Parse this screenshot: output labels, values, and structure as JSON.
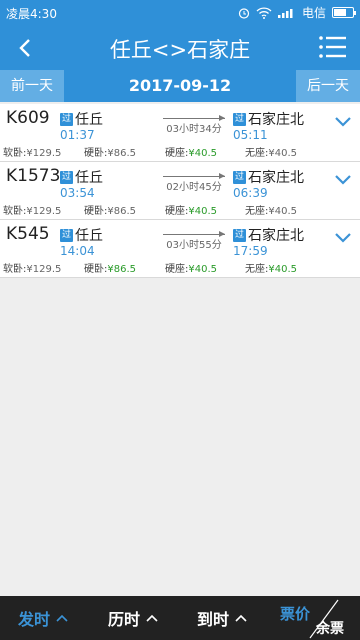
{
  "status_bar": {
    "time": "凌晨4:30",
    "carrier": "电信"
  },
  "header": {
    "title": "任丘<>石家庄"
  },
  "date_bar": {
    "prev_day": "前一天",
    "date": "2017-09-12",
    "next_day": "后一天"
  },
  "trains": [
    {
      "train_no": "K609",
      "pass_badge": "过",
      "dep_station": "任丘",
      "dep_time": "01:37",
      "duration": "03小时34分",
      "arr_station": "石家庄北",
      "arr_time": "05:11",
      "fares": [
        {
          "label": "软卧:",
          "value": "¥129.5",
          "available": false
        },
        {
          "label": "硬卧:",
          "value": "¥86.5",
          "available": false
        },
        {
          "label": "硬座:",
          "value": "¥40.5",
          "available": true
        },
        {
          "label": "无座:",
          "value": "¥40.5",
          "available": false
        }
      ]
    },
    {
      "train_no": "K1573",
      "pass_badge": "过",
      "dep_station": "任丘",
      "dep_time": "03:54",
      "duration": "02小时45分",
      "arr_station": "石家庄北",
      "arr_time": "06:39",
      "fares": [
        {
          "label": "软卧:",
          "value": "¥129.5",
          "available": false
        },
        {
          "label": "硬卧:",
          "value": "¥86.5",
          "available": false
        },
        {
          "label": "硬座:",
          "value": "¥40.5",
          "available": true
        },
        {
          "label": "无座:",
          "value": "¥40.5",
          "available": false
        }
      ]
    },
    {
      "train_no": "K545",
      "pass_badge": "过",
      "dep_station": "任丘",
      "dep_time": "14:04",
      "duration": "03小时55分",
      "arr_station": "石家庄北",
      "arr_time": "17:59",
      "fares": [
        {
          "label": "软卧:",
          "value": "¥129.5",
          "available": false
        },
        {
          "label": "硬卧:",
          "value": "¥86.5",
          "available": true
        },
        {
          "label": "硬座:",
          "value": "¥40.5",
          "available": true
        },
        {
          "label": "无座:",
          "value": "¥40.5",
          "available": true
        }
      ]
    }
  ],
  "bottom_bar": {
    "sort_departure": "发时",
    "sort_duration": "历时",
    "sort_arrival": "到时",
    "sort_price": "票价",
    "sort_remaining": "余票"
  },
  "colors": {
    "primary": "#2f90d8",
    "available": "#2a9b2a",
    "bottom_bg": "#222222"
  },
  "icons": [
    "back-icon",
    "menu-icon",
    "chevron-down-icon",
    "caret-up-icon",
    "wifi-icon",
    "signal-icon",
    "battery-icon",
    "alarm-icon"
  ]
}
